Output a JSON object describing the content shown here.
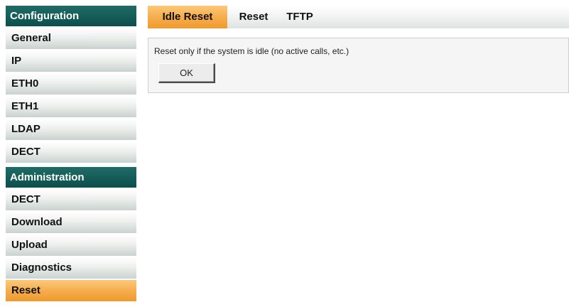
{
  "sidebar": {
    "configuration": {
      "header": "Configuration",
      "items": [
        "General",
        "IP",
        "ETH0",
        "ETH1",
        "LDAP",
        "DECT"
      ]
    },
    "administration": {
      "header": "Administration",
      "items": [
        "DECT",
        "Download",
        "Upload",
        "Diagnostics",
        "Reset"
      ],
      "active_item": "Reset"
    }
  },
  "tabs": {
    "items": [
      "Idle Reset",
      "Reset",
      "TFTP"
    ],
    "active": "Idle Reset"
  },
  "panel": {
    "description": "Reset only if the system is idle (no active calls, etc.)",
    "ok_label": "OK"
  },
  "colors": {
    "section_header": "#0c4f4c",
    "active_orange": "#f5ad4d"
  }
}
